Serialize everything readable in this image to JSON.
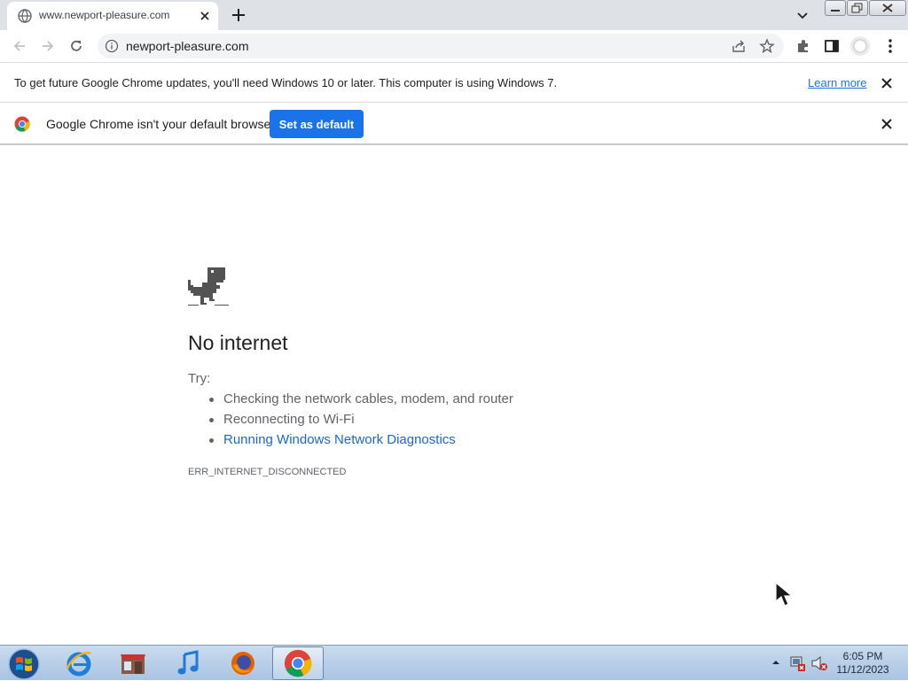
{
  "tab": {
    "title": "www.newport-pleasure.com"
  },
  "omnibox": {
    "url": "newport-pleasure.com"
  },
  "infobar_update": {
    "message": "To get future Google Chrome updates, you'll need Windows 10 or later. This computer is using Windows 7.",
    "link_label": "Learn more"
  },
  "infobar_default": {
    "message": "Google Chrome isn't your default browser",
    "button_label": "Set as default"
  },
  "error_page": {
    "title": "No internet",
    "try_label": "Try:",
    "suggestions": [
      "Checking the network cables, modem, and router",
      "Reconnecting to Wi-Fi",
      "Running Windows Network Diagnostics"
    ],
    "error_code": "ERR_INTERNET_DISCONNECTED"
  },
  "taskbar": {
    "apps": [
      "internet-explorer-icon",
      "store-icon",
      "itunes-icon",
      "firefox-icon",
      "chrome-icon"
    ],
    "active_app": "chrome-icon",
    "time": "6:05 PM",
    "date": "11/12/2023"
  },
  "colors": {
    "accent": "#1a73e8",
    "link": "#1967d2",
    "tabstrip": "#dee1e6",
    "taskbar": "#b9cfe8"
  }
}
